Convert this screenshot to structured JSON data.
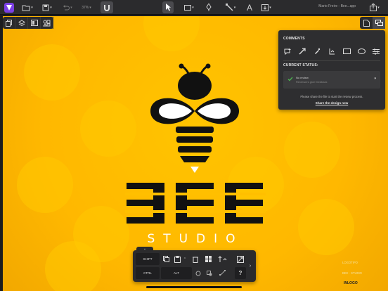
{
  "toolbar": {
    "zoom": "37%",
    "doc_title": "Mario Freire - Bee...app"
  },
  "comments": {
    "title": "COMMENTS",
    "current_status_title": "CURRENT STATUS:",
    "status_label": "No review",
    "status_sub": "Reviewers give feedback",
    "info": "Please share the file to start the review process.",
    "share_link": "Share the design now"
  },
  "logo": {
    "studio": "STUDIO"
  },
  "keys": {
    "shift": "SHIFT",
    "ctrl": "CTRL",
    "alt": "ALT",
    "help": "?"
  },
  "bottom_labels": {
    "l1": "LOGOTIPO",
    "l2": "BEE · STUDIO",
    "l3": "INLOGO"
  },
  "colors": {
    "accent": "#4caf50",
    "canvas": "#ffbf00",
    "brand": "#7b3fe4"
  }
}
